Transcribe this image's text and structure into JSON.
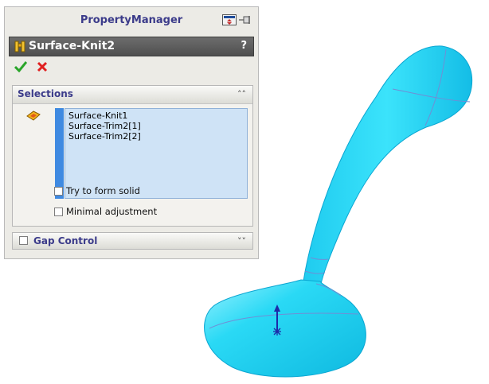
{
  "property_manager": {
    "title": "PropertyManager",
    "feature_name": "Surface-Knit2",
    "help_label": "?",
    "ok_icon": "checkmark-icon",
    "cancel_icon": "x-icon"
  },
  "selections": {
    "title": "Selections",
    "items": [
      "Surface-Knit1",
      "Surface-Trim2[1]",
      "Surface-Trim2[2]"
    ],
    "options": [
      {
        "label": "Try to form solid",
        "checked": false
      },
      {
        "label": "Minimal adjustment",
        "checked": false
      }
    ]
  },
  "gap_control": {
    "title": "Gap Control",
    "checked": false
  },
  "colors": {
    "accent_blue": "#3f8ae1",
    "header_text": "#3b3b8a",
    "model_cyan": "#29d6f4"
  }
}
